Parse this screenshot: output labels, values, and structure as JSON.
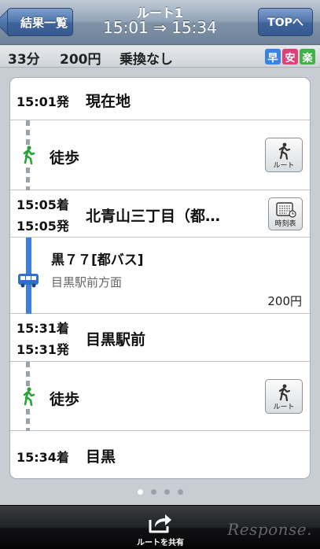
{
  "nav": {
    "back_label": "結果一覧",
    "title": "ルート1",
    "subtitle": "15:01 ⇒ 15:34",
    "top_label": "TOPへ"
  },
  "summary": {
    "duration": "33分",
    "fare": "200円",
    "transfer": "乗換なし",
    "badges": [
      {
        "label": "早",
        "color": "#3b82e8"
      },
      {
        "label": "安",
        "color": "#e0407a"
      },
      {
        "label": "楽",
        "color": "#3fb24a"
      }
    ]
  },
  "route": {
    "start": {
      "time": "15:01発",
      "station": "現在地"
    },
    "walk1": {
      "label": "徒歩",
      "button_label": "ルート",
      "icon": "walking-person-icon"
    },
    "stop1": {
      "arrive": "15:05着",
      "depart": "15:05発",
      "station": "北青山三丁目（都…",
      "timetable_label": "時刻表"
    },
    "bus": {
      "name": "黒７７[都バス]",
      "direction": "目黒駅前方面",
      "fare": "200円",
      "icon": "bus-icon",
      "line_color": "#3c7fe0"
    },
    "stop2": {
      "arrive": "15:31着",
      "depart": "15:31発",
      "station": "目黒駅前"
    },
    "walk2": {
      "label": "徒歩",
      "button_label": "ルート",
      "icon": "walking-person-icon"
    },
    "end": {
      "time": "15:34着",
      "station": "目黒"
    }
  },
  "pager": {
    "count": 4,
    "active": 0
  },
  "toolbar": {
    "share_label": "ルートを共有",
    "watermark": "Response."
  }
}
